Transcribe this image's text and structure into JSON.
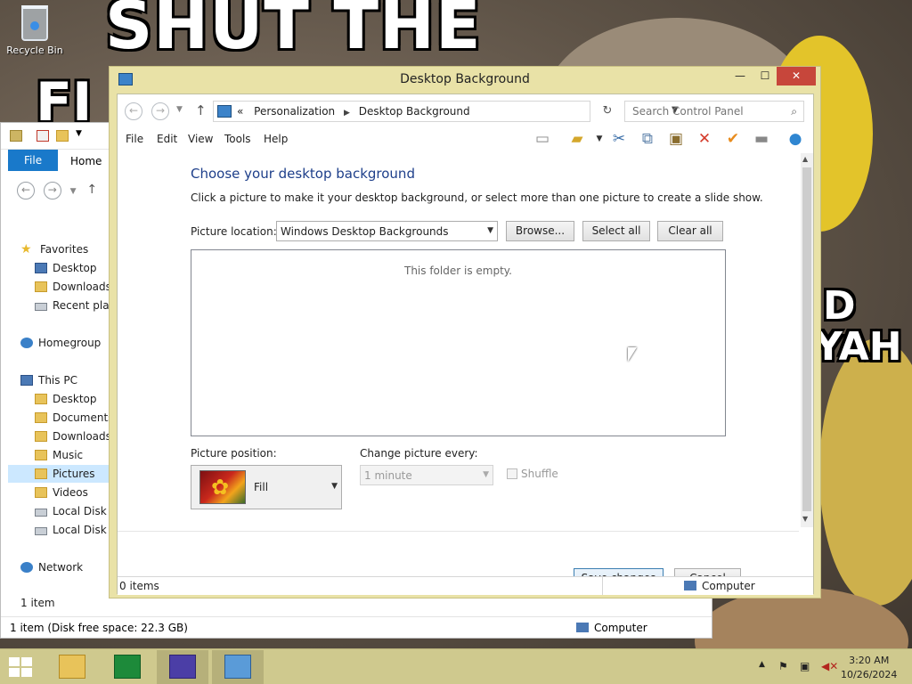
{
  "desktop": {
    "recycle_bin_label": "Recycle Bin",
    "wallpaper_text_top": "SHUT THE",
    "wallpaper_text_fragment": "FI",
    "wallpaper_text_right_1": "D",
    "wallpaper_text_right_2": "YAH"
  },
  "explorer": {
    "tabs": {
      "file": "File",
      "home": "Home"
    },
    "favorites": "Favorites",
    "fav_items": [
      "Desktop",
      "Downloads",
      "Recent places"
    ],
    "homegroup": "Homegroup",
    "this_pc": "This PC",
    "pc_items": [
      "Desktop",
      "Documents",
      "Downloads",
      "Music",
      "Pictures",
      "Videos",
      "Local Disk (C:)",
      "Local Disk (D:)"
    ],
    "network": "Network",
    "item_count": "1 item",
    "status_text": "1 item (Disk free space: 22.3 GB)",
    "status_computer": "Computer"
  },
  "dialog": {
    "title": "Desktop Background",
    "window_buttons": {
      "minimize": "—",
      "maximize": "☐",
      "close": "✕"
    },
    "address": {
      "overflow": "«",
      "crumbs": [
        "Personalization",
        "Desktop Background"
      ]
    },
    "search_placeholder": "Search Control Panel",
    "menu": [
      "File",
      "Edit",
      "View",
      "Tools",
      "Help"
    ],
    "heading": "Choose your desktop background",
    "subtext": "Click a picture to make it your desktop background, or select more than one picture to create a slide show.",
    "picture_location_label": "Picture location:",
    "picture_location_value": "Windows Desktop Backgrounds",
    "browse_button": "Browse...",
    "select_all_button": "Select all",
    "clear_all_button": "Clear all",
    "empty_message": "This folder is empty.",
    "picture_position_label": "Picture position:",
    "picture_position_value": "Fill",
    "change_picture_label": "Change picture every:",
    "change_picture_value": "1 minute",
    "shuffle_label": "Shuffle",
    "save_button": "Save changes",
    "cancel_button": "Cancel",
    "status_items": "0 items",
    "status_computer": "Computer"
  },
  "taskbar": {
    "clock_time": "3:20 AM",
    "clock_date": "10/26/2024",
    "apps": [
      "file-explorer",
      "store",
      "settings",
      "control-panel"
    ]
  },
  "colors": {
    "titlebar_accent": "#e9e2a7",
    "close_button": "#c7463b",
    "heading_blue": "#1e3f8a",
    "file_tab": "#1979ca",
    "taskbar": "#cfc98e"
  }
}
